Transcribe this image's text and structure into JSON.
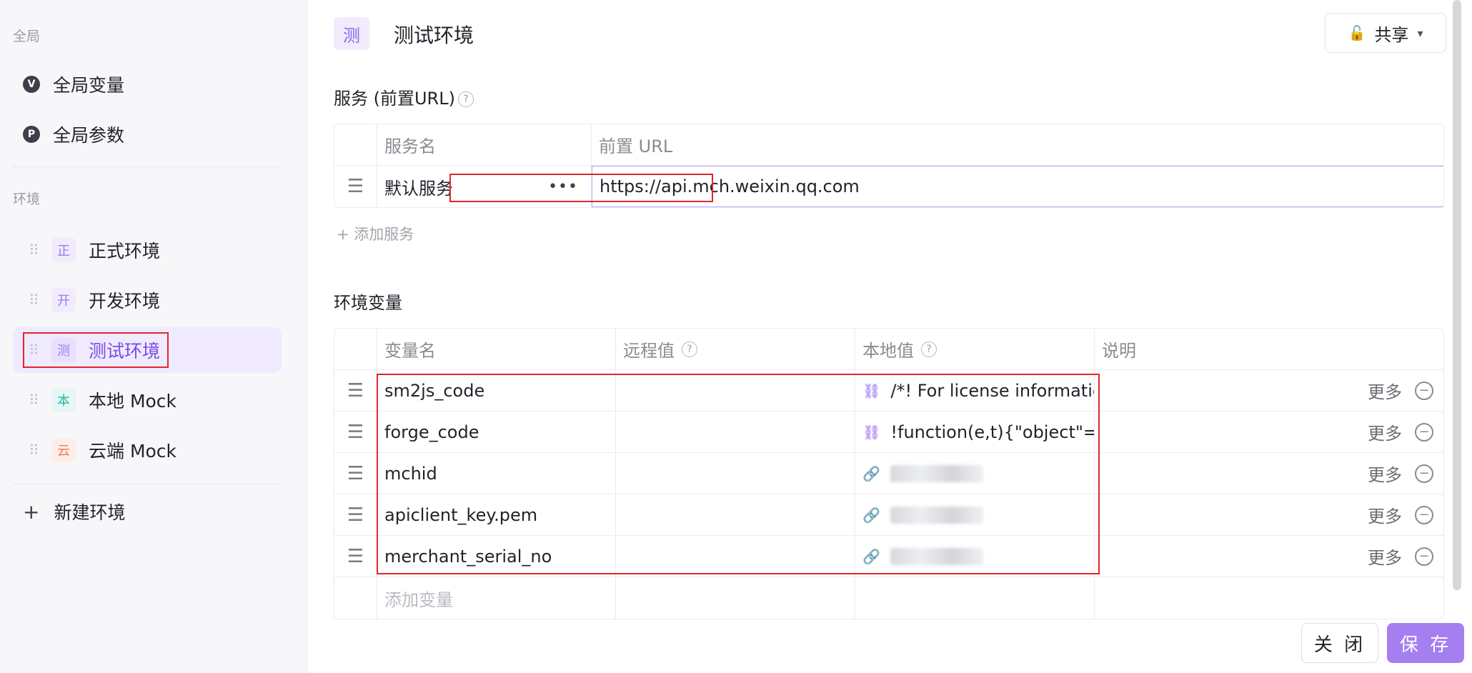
{
  "sidebar": {
    "global_label": "全局",
    "global_items": [
      {
        "icon": "V",
        "label": "全局变量"
      },
      {
        "icon": "P",
        "label": "全局参数"
      }
    ],
    "env_label": "环境",
    "env_items": [
      {
        "badge": "正",
        "label": "正式环境",
        "color": "#9b7cf0",
        "bg": "#f1ecfd"
      },
      {
        "badge": "开",
        "label": "开发环境",
        "color": "#9b7cf0",
        "bg": "#f1ecfd"
      },
      {
        "badge": "测",
        "label": "测试环境",
        "color": "#9b7cf0",
        "bg": "#e9e1fc",
        "active": true
      },
      {
        "badge": "本",
        "label": "本地 Mock",
        "color": "#2bb5a8",
        "bg": "#e6f7f5"
      },
      {
        "badge": "云",
        "label": "云端 Mock",
        "color": "#f07a4f",
        "bg": "#fdeee8"
      }
    ],
    "new_env_label": "新建环境"
  },
  "header": {
    "badge": "测",
    "title": "测试环境",
    "share_label": "共享"
  },
  "services": {
    "title": "服务 (前置URL)",
    "columns": [
      "服务名",
      "前置 URL"
    ],
    "rows": [
      {
        "name": "默认服务",
        "url": "https://api.mch.weixin.qq.com"
      }
    ],
    "add_label": "+ 添加服务"
  },
  "variables": {
    "title": "环境变量",
    "columns": [
      "变量名",
      "远程值",
      "本地值",
      "说明"
    ],
    "rows": [
      {
        "name": "sm2js_code",
        "remote": "",
        "local": "/*! For license information",
        "more": "更多"
      },
      {
        "name": "forge_code",
        "remote": "",
        "local": "!function(e,t){\"object\"==ty",
        "more": "更多"
      },
      {
        "name": "mchid",
        "remote": "",
        "local": "",
        "more": "更多"
      },
      {
        "name": "apiclient_key.pem",
        "remote": "",
        "local": "",
        "more": "更多"
      },
      {
        "name": "merchant_serial_no",
        "remote": "",
        "local": "",
        "more": "更多"
      }
    ],
    "add_placeholder": "添加变量"
  },
  "footer": {
    "close_label": "关 闭",
    "save_label": "保 存"
  },
  "colors": {
    "accent": "#7a4be8",
    "highlight_border": "#e0262e",
    "save_button": "#a57ff0"
  }
}
